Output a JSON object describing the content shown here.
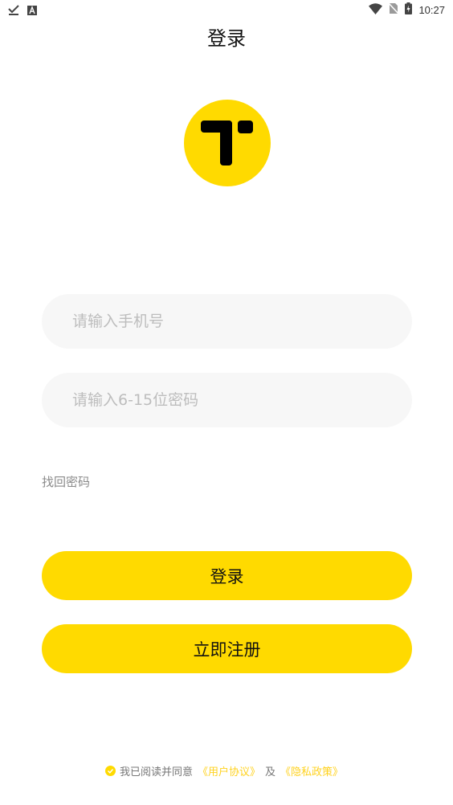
{
  "status_bar": {
    "time": "10:27",
    "left_icons": [
      "download-done-icon",
      "text-a-icon"
    ],
    "right_icons": [
      "wifi-icon",
      "no-sim-icon",
      "battery-charging-icon"
    ]
  },
  "header": {
    "title": "登录"
  },
  "logo": {
    "icon": "app-logo-icon",
    "background": "#FFDA00"
  },
  "form": {
    "phone_placeholder": "请输入手机号",
    "password_placeholder": "请输入6-15位密码",
    "forgot_label": "找回密码"
  },
  "buttons": {
    "login_label": "登录",
    "register_label": "立即注册",
    "accent": "#FFDA00"
  },
  "agreement": {
    "prefix": "我已阅读并同意",
    "user_agreement": "《用户协议》",
    "and": "及",
    "privacy_policy": "《隐私政策》",
    "link_color": "#FFD21F"
  }
}
